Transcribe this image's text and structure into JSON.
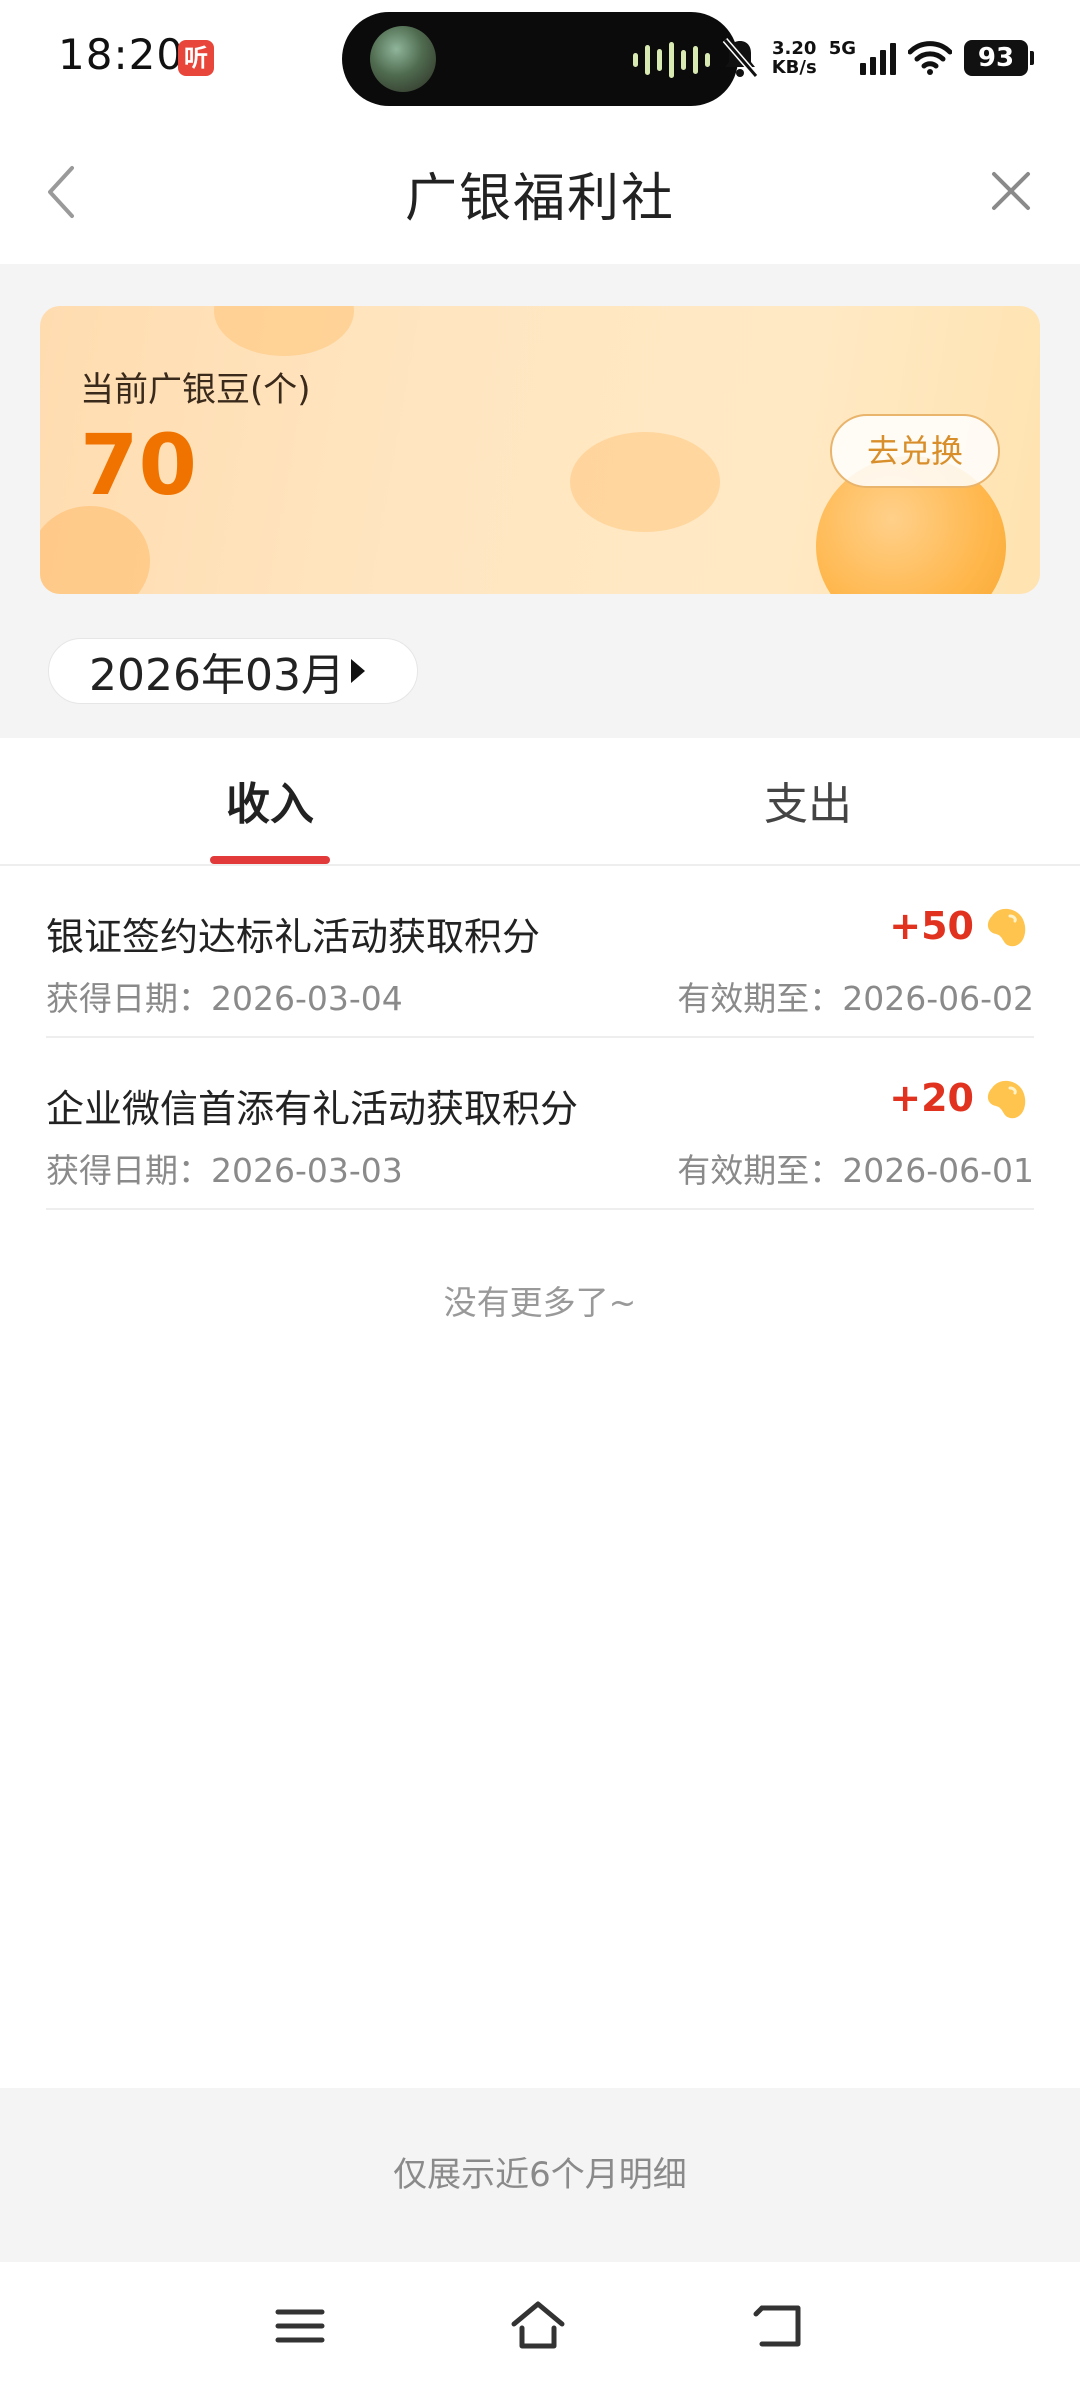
{
  "status_bar": {
    "time": "18:20",
    "listen_badge": "听",
    "net_speed_value": "3.20",
    "net_speed_unit": "KB/s",
    "network_type": "5G",
    "battery": "93"
  },
  "nav": {
    "title": "广银福利社",
    "back_icon": "chevron-left-icon",
    "close_icon": "close-icon"
  },
  "card": {
    "label": "当前广银豆(个)",
    "value": "70",
    "redeem_label": "去兑换",
    "accent_color": "#f07300"
  },
  "month_picker": {
    "label": "2026年03月"
  },
  "tabs": [
    {
      "label": "收入",
      "active": true
    },
    {
      "label": "支出",
      "active": false
    }
  ],
  "records": [
    {
      "title": "银证签约达标礼活动获取积分",
      "points": "+50",
      "obtained": "获得日期：2026-03-04",
      "expiry": "有效期至：2026-06-02"
    },
    {
      "title": "企业微信首添有礼活动获取积分",
      "points": "+20",
      "obtained": "获得日期：2026-03-03",
      "expiry": "有效期至：2026-06-01"
    }
  ],
  "no_more_text": "没有更多了~",
  "footer_note": "仅展示近6个月明细",
  "system_nav": {
    "menu_icon": "menu-icon",
    "home_icon": "home-icon",
    "back_icon": "back-icon"
  }
}
